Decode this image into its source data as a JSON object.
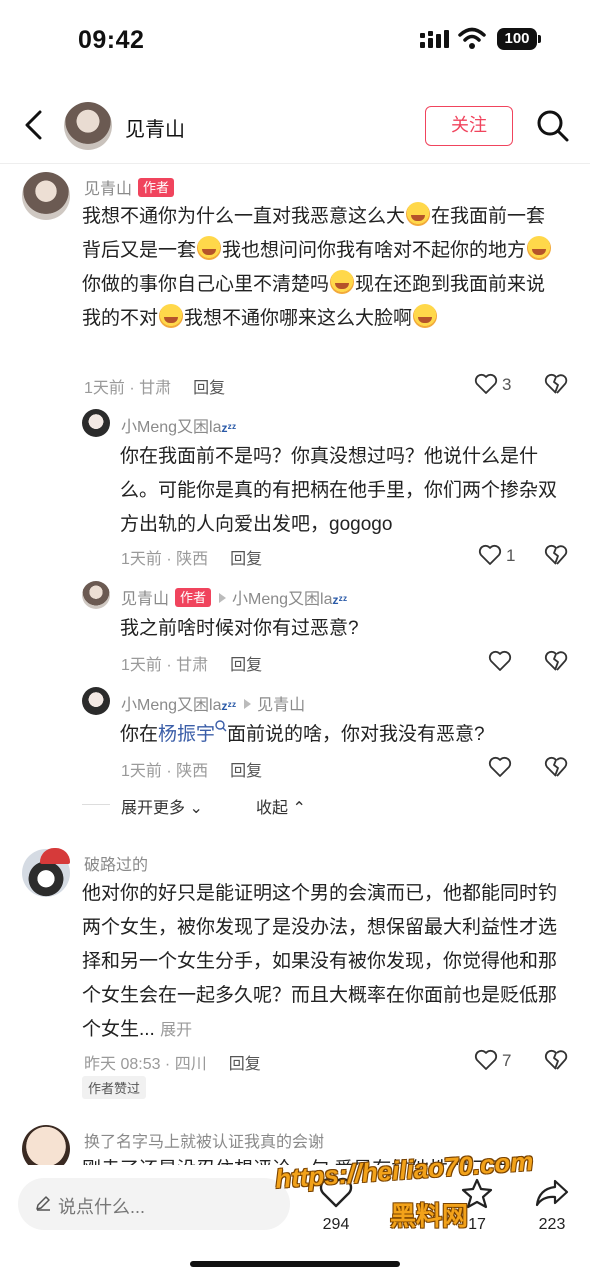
{
  "status_bar": {
    "time": "09:42",
    "battery": "100"
  },
  "header": {
    "user_name": "见青山",
    "follow_label": "关注"
  },
  "labels": {
    "author_tag": "作者",
    "reply": "回复",
    "expand_more": "展开更多",
    "collapse": "收起",
    "expand": "展开",
    "author_liked": "作者赞过"
  },
  "comments": [
    {
      "user": "见青山",
      "text": "我想不通你为什么一直对我恶意这么大😂在我面前一套背后又是一套😂我也想问问你我有啥对不起你的地方😂你做的事你自己心里不清楚吗😂现在还跑到我面前来说我的不对😂我想不通你哪来这么大脸啊😂",
      "meta": "1天前 · 甘肃",
      "likes": "3",
      "replies": [
        {
          "user": "小Meng又困la",
          "text": "你在我面前不是吗？你真没想过吗？他说什么是什么。可能你是真的有把柄在他手里，你们两个掺杂双方出轨的人向爱出发吧，gogogo",
          "meta": "1天前 · 陕西",
          "likes": "1"
        },
        {
          "user": "见青山",
          "reply_to": "小Meng又困la",
          "text": "我之前啥时候对你有过恶意?",
          "meta": "1天前 · 甘肃"
        },
        {
          "user": "小Meng又困la",
          "reply_to": "见青山",
          "text_before": "你在",
          "mention": "杨振宇",
          "text_after": "面前说的啥，你对我没有恶意?",
          "meta": "1天前 · 陕西"
        }
      ]
    },
    {
      "user": "破路过的",
      "text": "他对你的好只是能证明这个男的会演而已，他都能同时钓两个女生，被你发现了是没办法，想保留最大利益性才选择和另一个女生分手，如果没有被你发现，你觉得他和那个女生会在一起多久呢？而且大概率在你面前也是贬低那个女生...",
      "meta": "昨天 08:53 · 四川",
      "likes": "7"
    },
    {
      "user": "换了名字马上就被认证我真的会谢",
      "text": "刚走了还是没忍住想评论一句 爱是有排他性 他不爱"
    }
  ],
  "bottom_bar": {
    "input_placeholder": "说点什么...",
    "likes_count": "294",
    "star_count": "17",
    "share_count": "223"
  },
  "watermark": {
    "line1": "https://heiliao70.com",
    "line2": "黑料网"
  }
}
